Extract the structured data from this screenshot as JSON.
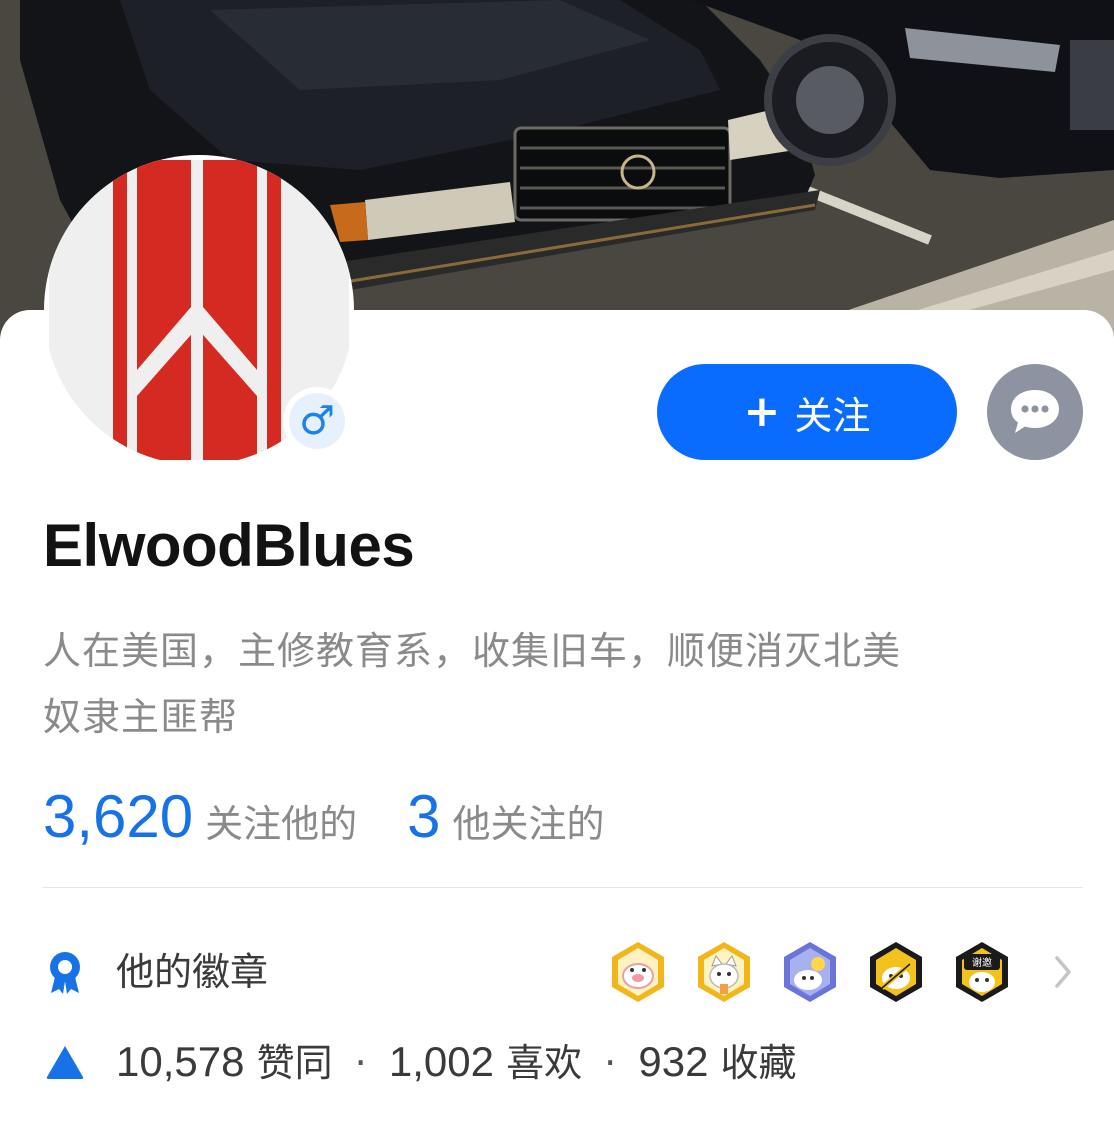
{
  "profile": {
    "username": "ElwoodBlues",
    "bio_line1": "人在美国，主修教育系，收集旧车，顺便消灭北美",
    "bio_line2": "奴隶主匪帮",
    "gender_symbol": "♂"
  },
  "actions": {
    "follow_plus": "+",
    "follow_label": "关注"
  },
  "stats": {
    "followers_count": "3,620",
    "followers_label": "关注他的",
    "following_count": "3",
    "following_label": "他关注的"
  },
  "badges": {
    "label": "他的徽章",
    "items": [
      {
        "icon": "gold-medal-pig-icon"
      },
      {
        "icon": "gold-medal-cat-icon"
      },
      {
        "icon": "purple-medal-moon-icon"
      },
      {
        "icon": "black-gold-medal-pen-icon"
      },
      {
        "icon": "black-gold-medal-thanks-icon",
        "text": "谢邀"
      }
    ]
  },
  "engagement": {
    "likes_count": "10,578",
    "likes_label": "赞同",
    "favorites_count": "1,002",
    "favorites_label": "喜欢",
    "collections_count": "932",
    "collections_label": "收藏",
    "separator": "·"
  },
  "colors": {
    "accent": "#0a6bff",
    "stat_blue": "#1772e8",
    "message_button": "#8d93a1",
    "avatar_red": "#d42a22"
  }
}
